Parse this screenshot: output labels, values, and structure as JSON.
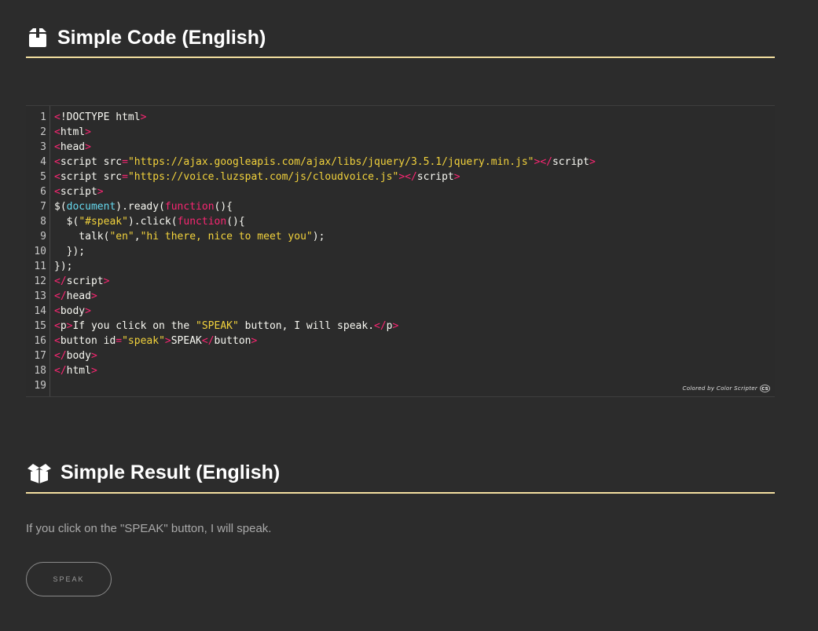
{
  "sections": {
    "code": {
      "title": "Simple Code (English)",
      "icon": "box-closed-icon"
    },
    "result": {
      "title": "Simple Result (English)",
      "icon": "box-open-icon"
    }
  },
  "code_block": {
    "language": "html",
    "line_numbers": [
      "1",
      "2",
      "3",
      "4",
      "5",
      "6",
      "7",
      "8",
      "9",
      "10",
      "11",
      "12",
      "13",
      "14",
      "15",
      "16",
      "17",
      "18",
      "19"
    ],
    "lines": [
      [
        [
          "pink",
          "<"
        ],
        [
          "white",
          "!DOCTYPE html"
        ],
        [
          "pink",
          ">"
        ]
      ],
      [
        [
          "pink",
          "<"
        ],
        [
          "white",
          "html"
        ],
        [
          "pink",
          ">"
        ]
      ],
      [
        [
          "pink",
          "<"
        ],
        [
          "white",
          "head"
        ],
        [
          "pink",
          ">"
        ]
      ],
      [
        [
          "pink",
          "<"
        ],
        [
          "white",
          "script src"
        ],
        [
          "pink",
          "="
        ],
        [
          "yellow",
          "\"https://ajax.googleapis.com/ajax/libs/jquery/3.5.1/jquery.min.js\""
        ],
        [
          "pink",
          "></"
        ],
        [
          "white",
          "script"
        ],
        [
          "pink",
          ">"
        ]
      ],
      [
        [
          "pink",
          "<"
        ],
        [
          "white",
          "script src"
        ],
        [
          "pink",
          "="
        ],
        [
          "yellow",
          "\"https://voice.luzspat.com/js/cloudvoice.js\""
        ],
        [
          "pink",
          "></"
        ],
        [
          "white",
          "script"
        ],
        [
          "pink",
          ">"
        ]
      ],
      [
        [
          "pink",
          "<"
        ],
        [
          "white",
          "script"
        ],
        [
          "pink",
          ">"
        ]
      ],
      [
        [
          "white",
          "$("
        ],
        [
          "cyan",
          "document"
        ],
        [
          "white",
          ").ready("
        ],
        [
          "pink",
          "function"
        ],
        [
          "white",
          "(){"
        ]
      ],
      [
        [
          "white",
          "  $("
        ],
        [
          "yellow",
          "\"#speak\""
        ],
        [
          "white",
          ").click("
        ],
        [
          "pink",
          "function"
        ],
        [
          "white",
          "(){"
        ]
      ],
      [
        [
          "white",
          "    talk("
        ],
        [
          "yellow",
          "\"en\""
        ],
        [
          "white",
          ","
        ],
        [
          "yellow",
          "\"hi there, nice to meet you\""
        ],
        [
          "white",
          ");"
        ]
      ],
      [
        [
          "white",
          "  });"
        ]
      ],
      [
        [
          "white",
          "});"
        ]
      ],
      [
        [
          "pink",
          "</"
        ],
        [
          "white",
          "script"
        ],
        [
          "pink",
          ">"
        ]
      ],
      [
        [
          "pink",
          "</"
        ],
        [
          "white",
          "head"
        ],
        [
          "pink",
          ">"
        ]
      ],
      [
        [
          "pink",
          "<"
        ],
        [
          "white",
          "body"
        ],
        [
          "pink",
          ">"
        ]
      ],
      [
        [
          "pink",
          "<"
        ],
        [
          "white",
          "p"
        ],
        [
          "pink",
          ">"
        ],
        [
          "white",
          "If you click on the "
        ],
        [
          "yellow",
          "\"SPEAK\""
        ],
        [
          "white",
          " button, I will speak."
        ],
        [
          "pink",
          "</"
        ],
        [
          "white",
          "p"
        ],
        [
          "pink",
          ">"
        ]
      ],
      [
        [
          "pink",
          "<"
        ],
        [
          "white",
          "button id"
        ],
        [
          "pink",
          "="
        ],
        [
          "yellow",
          "\"speak\""
        ],
        [
          "pink",
          ">"
        ],
        [
          "white",
          "SPEAK"
        ],
        [
          "pink",
          "</"
        ],
        [
          "white",
          "button"
        ],
        [
          "pink",
          ">"
        ]
      ],
      [
        [
          "pink",
          "</"
        ],
        [
          "white",
          "body"
        ],
        [
          "pink",
          ">"
        ]
      ],
      [
        [
          "pink",
          "</"
        ],
        [
          "white",
          "html"
        ],
        [
          "pink",
          ">"
        ]
      ],
      []
    ],
    "watermark": "Colored by Color Scripter",
    "watermark_badge": "cs"
  },
  "result": {
    "paragraph": "If you click on the \"SPEAK\" button, I will speak.",
    "button_label": "SPEAK"
  },
  "colors": {
    "background": "#2c2c2c",
    "heading_underline": "#f3dfa0",
    "code_tag": "#f92672",
    "code_string": "#f2d23c",
    "code_keyword": "#66d9ef",
    "code_text": "#f8f8f2"
  }
}
